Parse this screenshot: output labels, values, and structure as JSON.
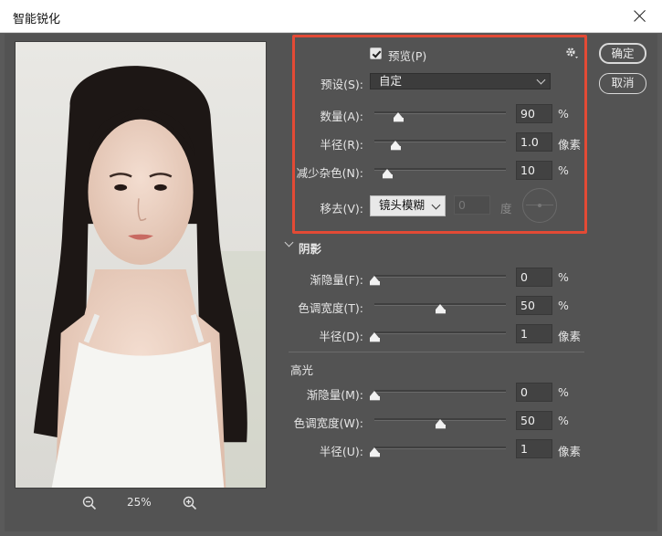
{
  "window": {
    "title": "智能锐化"
  },
  "preview": {
    "zoom": "25%",
    "zoom_out_icon": "zoom-out-icon",
    "zoom_in_icon": "zoom-in-icon"
  },
  "buttons": {
    "ok": "确定",
    "cancel": "取消"
  },
  "sharpen": {
    "preview_label": "预览(P)",
    "preview_checked": true,
    "preset_label": "预设(S):",
    "preset_value": "自定",
    "amount": {
      "label": "数量(A):",
      "value": "90",
      "unit": "%",
      "level": 0.18
    },
    "radius": {
      "label": "半径(R):",
      "value": "1.0",
      "unit": "像素",
      "level": 0.16
    },
    "noise": {
      "label": "减少杂色(N):",
      "value": "10",
      "unit": "%",
      "level": 0.1
    },
    "remove": {
      "label": "移去(V):",
      "value": "镜头模糊",
      "angle_value": "0",
      "angle_unit": "度"
    },
    "settings_icon": "gear-icon",
    "highlight_color": "#e34a35"
  },
  "shadow": {
    "title": "阴影",
    "fade": {
      "label": "渐隐量(F):",
      "value": "0",
      "unit": "%",
      "level": 0.0
    },
    "tonal": {
      "label": "色调宽度(T):",
      "value": "50",
      "unit": "%",
      "level": 0.5
    },
    "radius": {
      "label": "半径(D):",
      "value": "1",
      "unit": "像素",
      "level": 0.0
    }
  },
  "highlight": {
    "title": "高光",
    "fade": {
      "label": "渐隐量(M):",
      "value": "0",
      "unit": "%",
      "level": 0.0
    },
    "tonal": {
      "label": "色调宽度(W):",
      "value": "50",
      "unit": "%",
      "level": 0.5
    },
    "radius": {
      "label": "半径(U):",
      "value": "1",
      "unit": "像素",
      "level": 0.0
    }
  }
}
